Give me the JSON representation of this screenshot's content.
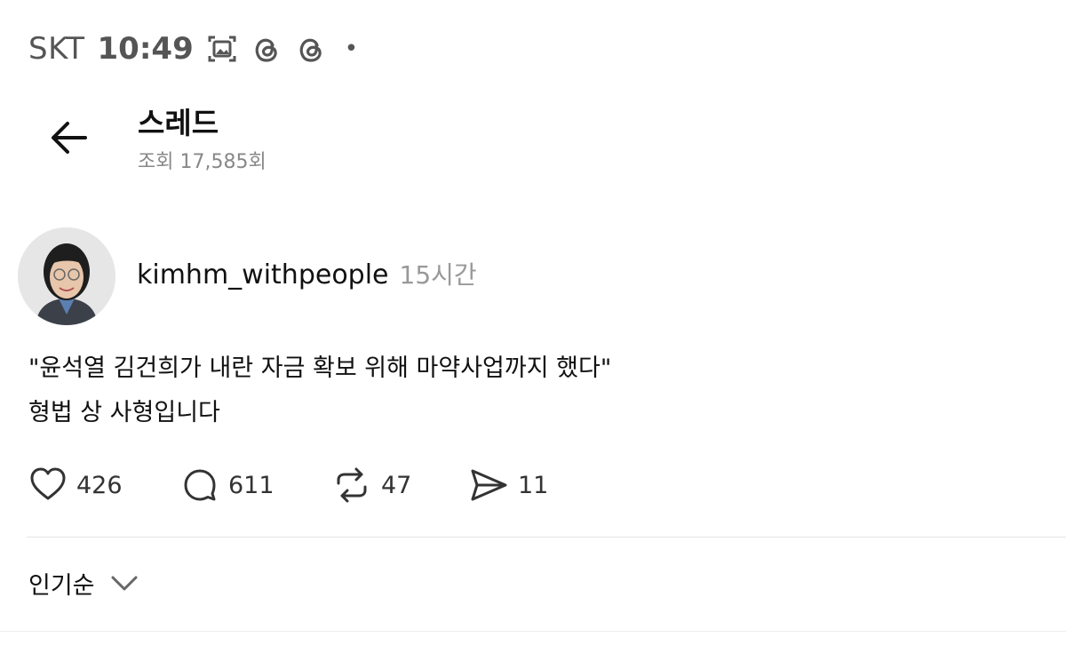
{
  "status_bar": {
    "carrier": "SKT",
    "time": "10:49",
    "icons": [
      "gallery-icon",
      "threads-icon",
      "threads-icon",
      "dot-indicator"
    ],
    "dot": "•"
  },
  "header": {
    "title": "스레드",
    "views": "조회 17,585회"
  },
  "post": {
    "author": {
      "username": "kimhm_withpeople",
      "time": "15시간"
    },
    "text_lines": [
      "\"윤석열 김건희가 내란 자금 확보 위해 마약사업까지 했다\"",
      "형법 상 사형입니다"
    ],
    "stats": {
      "likes": "426",
      "replies": "611",
      "reposts": "47",
      "shares": "11"
    }
  },
  "sort": {
    "label": "인기순"
  }
}
